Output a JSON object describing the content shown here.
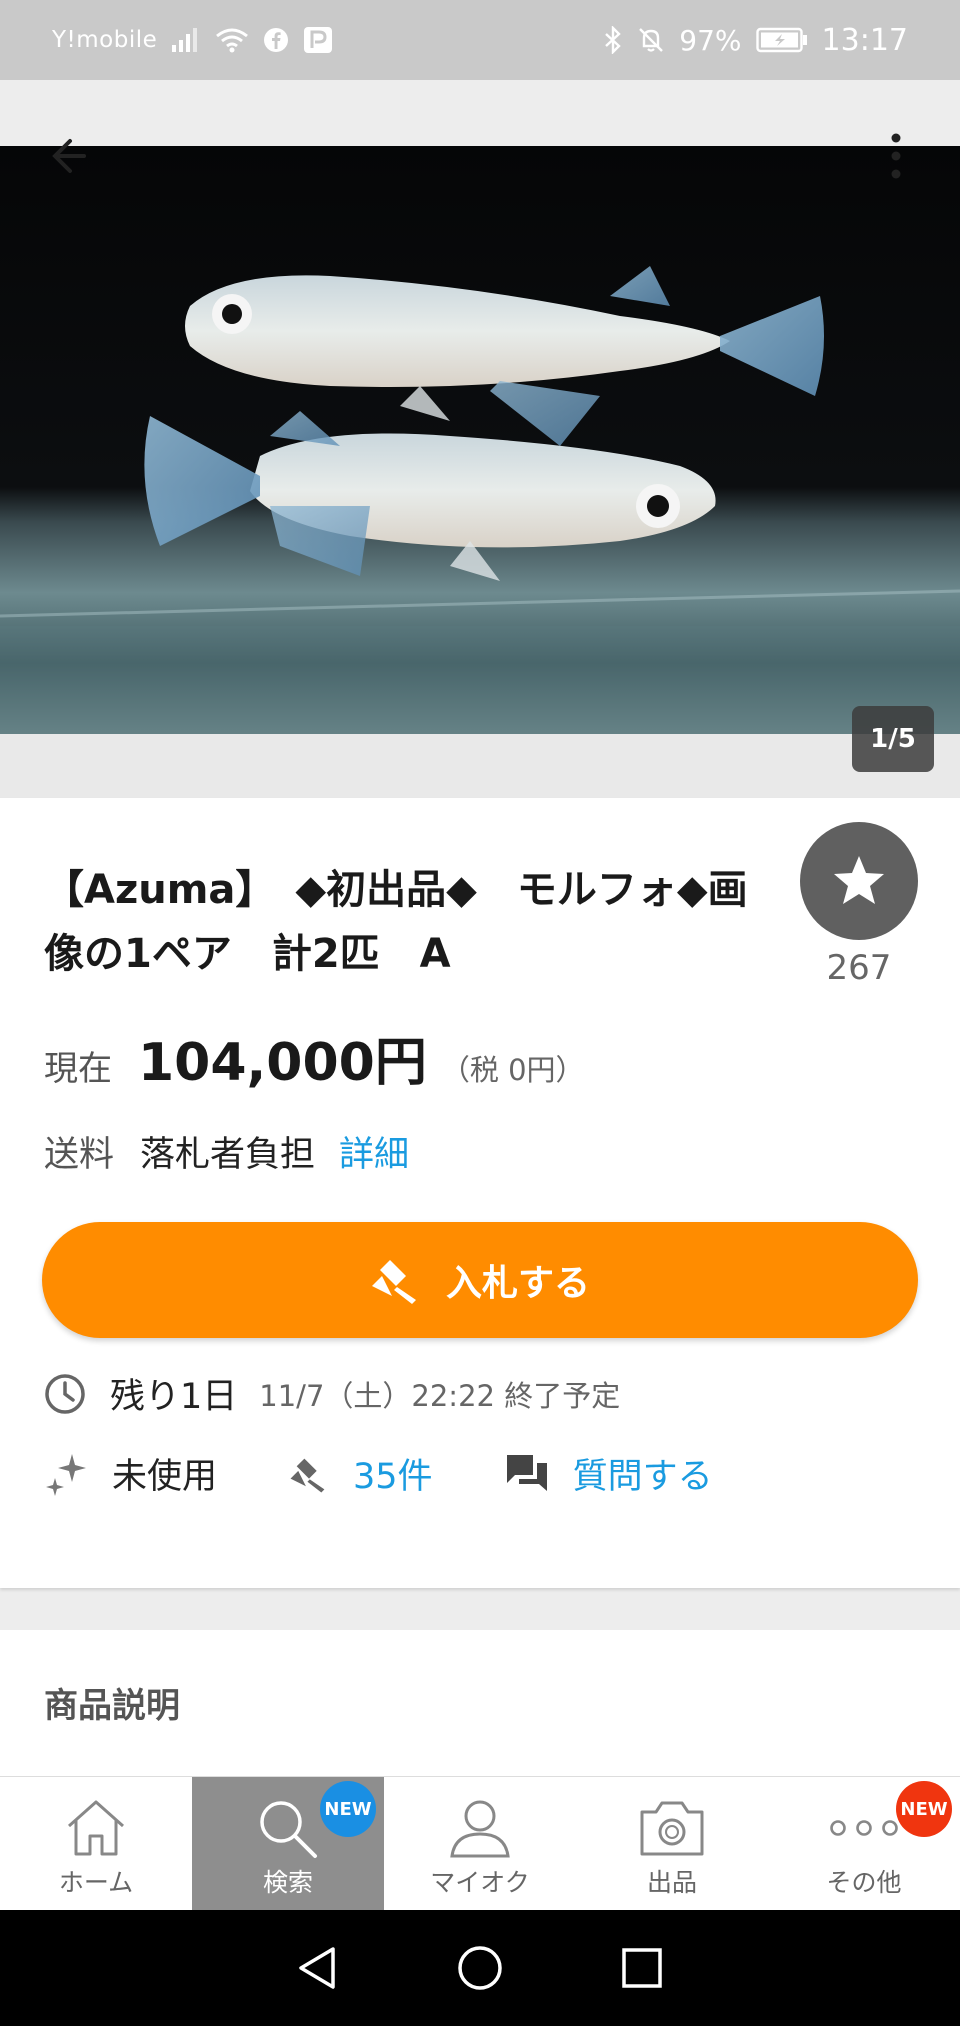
{
  "status_bar": {
    "carrier": "Y!mobile",
    "battery": "97%",
    "time": "13:17"
  },
  "gallery": {
    "counter": "1/5",
    "photo_description_icon": "fish-photo"
  },
  "item": {
    "title": "【Azuma】　◆初出品◆　モルフォ◆画像の1ペア　計2匹　A",
    "watch_count": "267",
    "price_label": "現在",
    "price_value": "104,000円",
    "price_tax": "（税 0円）",
    "shipping_label": "送料",
    "shipping_value": "落札者負担",
    "shipping_link": "詳細",
    "bid_button": "入札する",
    "time_left": "残り1日",
    "end_time": "11/7（土）22:22 終了予定",
    "condition": "未使用",
    "bid_count": "35件",
    "question_link": "質問する"
  },
  "description_section": {
    "title": "商品説明"
  },
  "tab_bar": {
    "items": [
      {
        "label": "ホーム",
        "icon": "home-icon",
        "active": false
      },
      {
        "label": "検索",
        "icon": "search-icon",
        "active": true,
        "badge": "NEW"
      },
      {
        "label": "マイオク",
        "icon": "person-icon",
        "active": false
      },
      {
        "label": "出品",
        "icon": "camera-icon",
        "active": false
      },
      {
        "label": "その他",
        "icon": "more-icon",
        "active": false,
        "badge": "NEW"
      }
    ]
  },
  "colors": {
    "accent_orange": "#ff8c00",
    "link_blue": "#1a9be0",
    "badge_blue": "#1a8fe3",
    "badge_red": "#f0350f"
  }
}
